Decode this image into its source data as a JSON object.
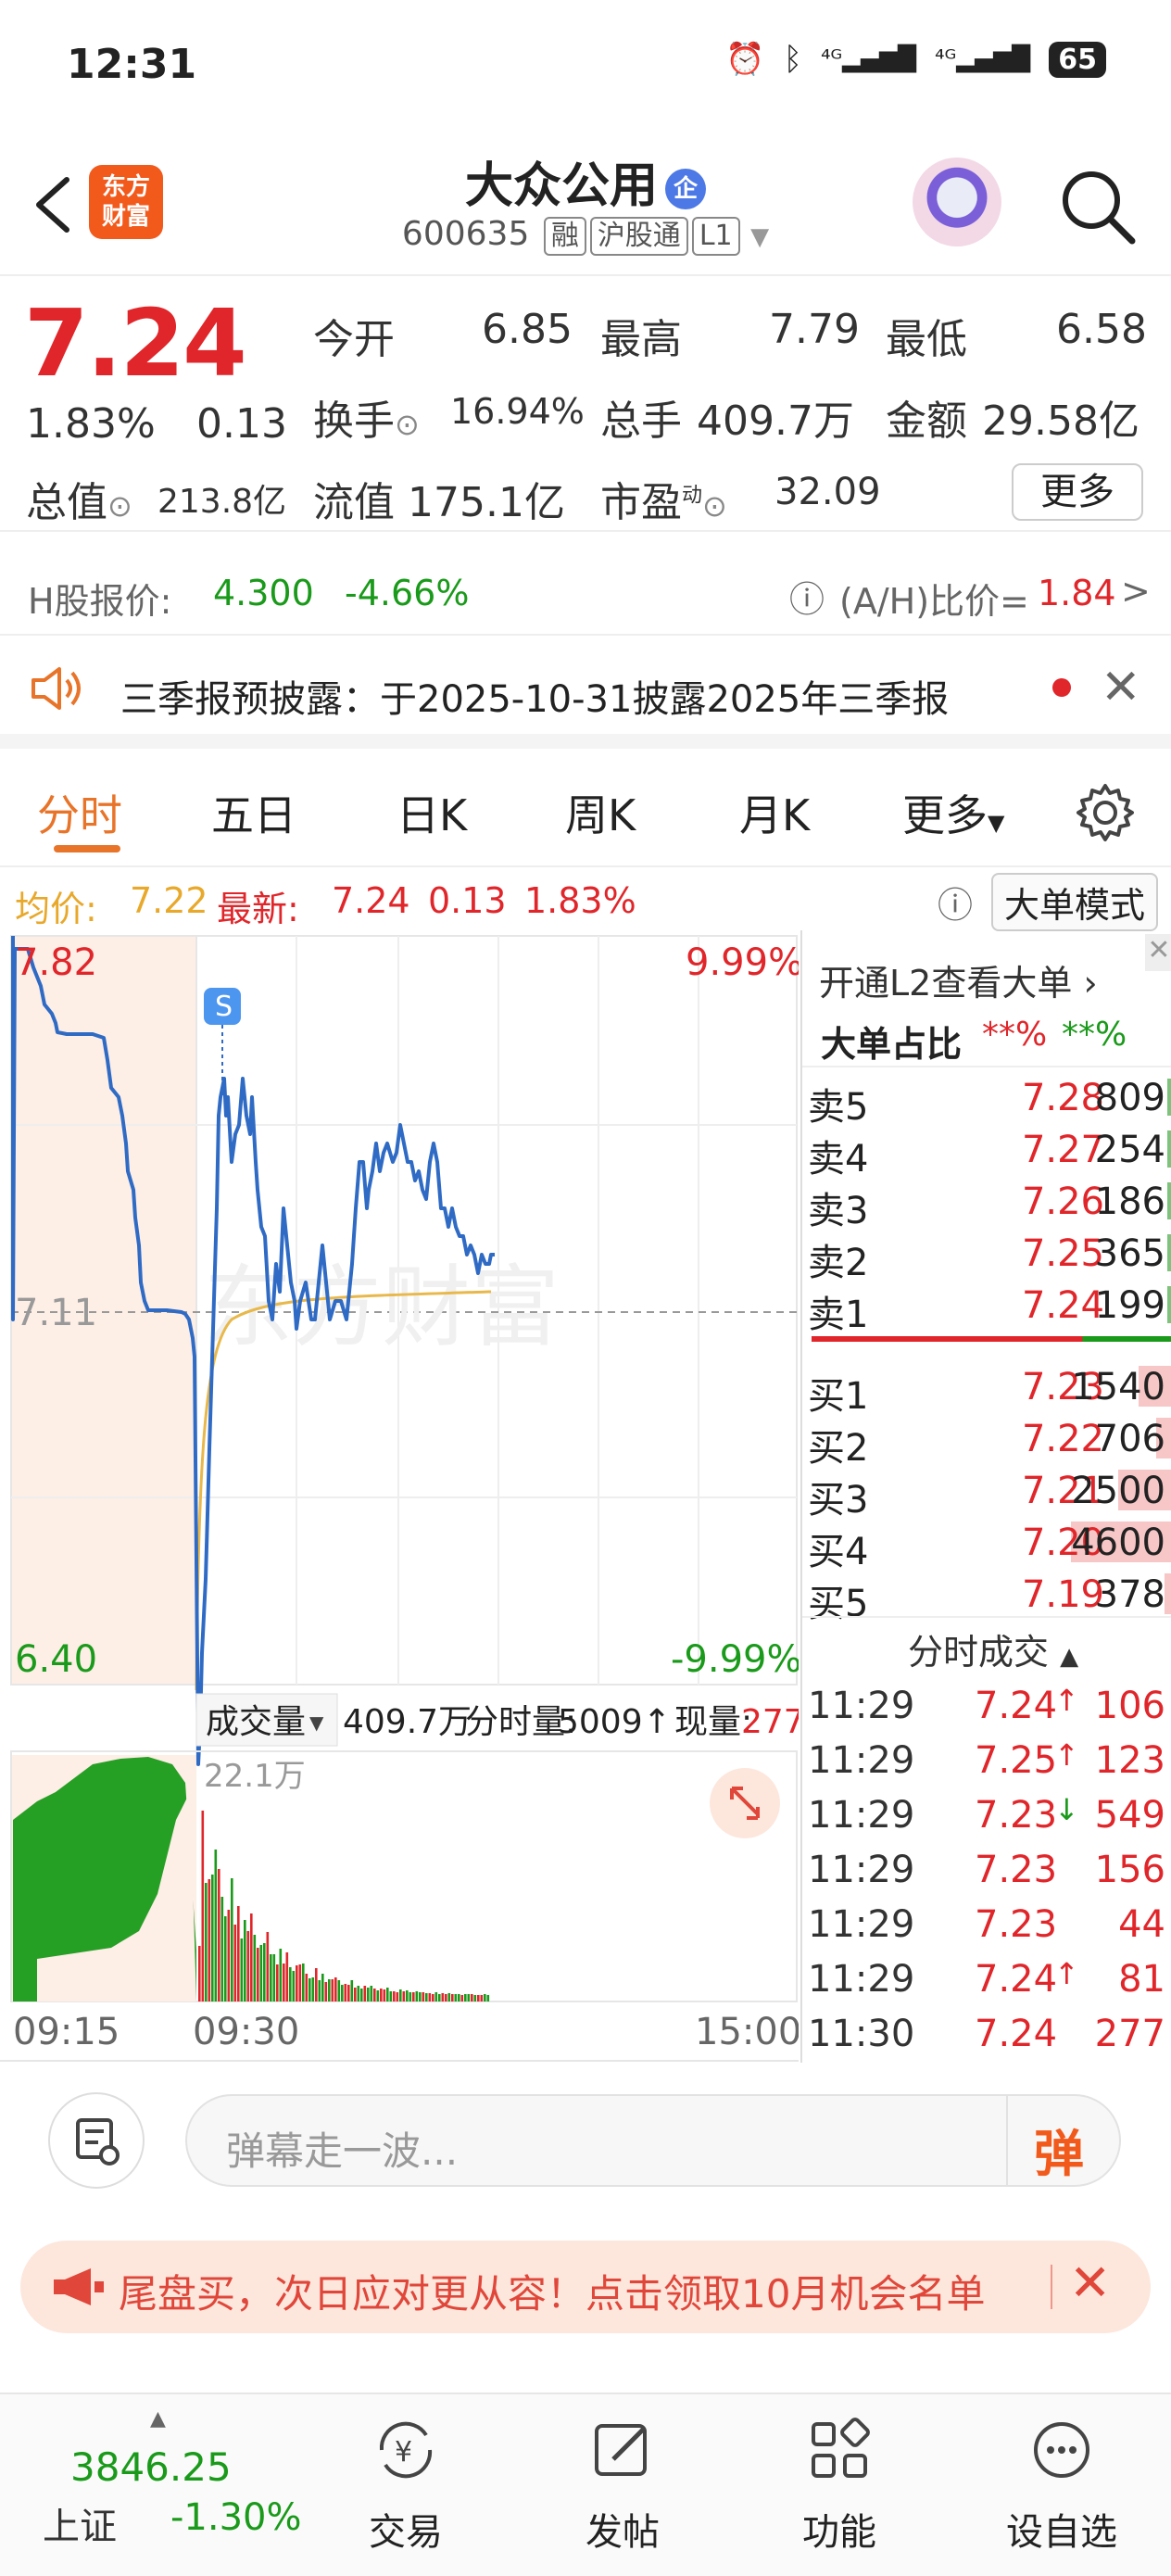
{
  "status_bar": {
    "time": "12:31",
    "battery": "65"
  },
  "header": {
    "title": "大众公用",
    "badge": "企",
    "code": "600635",
    "tags": [
      "融",
      "沪股通",
      "L1"
    ],
    "logo_text": "东方财富"
  },
  "quote": {
    "price": "7.24",
    "change_pct": "1.83%",
    "change": "0.13",
    "open_label": "今开",
    "open": "6.85",
    "high_label": "最高",
    "high": "7.79",
    "low_label": "最低",
    "low": "6.58",
    "turnover_label": "换手",
    "turnover": "16.94%",
    "volume_label": "总手",
    "volume": "409.7万",
    "amount_label": "金额",
    "amount": "29.58亿",
    "mktcap_label": "总值",
    "mktcap": "213.8亿",
    "float_label": "流值",
    "float": "175.1亿",
    "pe_label": "市盈",
    "pe_sup": "动",
    "pe": "32.09",
    "more": "更多"
  },
  "hshare": {
    "label": "H股报价:",
    "price": "4.300",
    "pct": "-4.66%",
    "ratio_label": "(A/H)比价=",
    "ratio": "1.84"
  },
  "notice": {
    "text": "三季报预披露：于2025-10-31披露2025年三季报"
  },
  "tabs": [
    "分时",
    "五日",
    "日K",
    "周K",
    "月K",
    "更多"
  ],
  "avg_line": {
    "avg_label": "均价:",
    "avg": "7.22",
    "last_label": "最新:",
    "last": "7.24",
    "chg": "0.13",
    "pct": "1.83%",
    "mode": "大单模式"
  },
  "chart": {
    "y_top": "7.82",
    "y_mid": "7.11",
    "y_bottom": "6.40",
    "pct_top": "9.99%",
    "pct_bottom": "-9.99%",
    "vol_label": "成交量",
    "vol_total": "409.7万",
    "per_min_label": "分时量:",
    "per_min": "5009",
    "now_label": "现量:",
    "now": "277",
    "vol_max": "22.1万",
    "times": [
      "09:15",
      "09:30",
      "15:00"
    ],
    "s_marker": "S",
    "watermark": "东方财富"
  },
  "depth": {
    "l2_text": "开通L2查看大单",
    "ratio_label": "大单占比",
    "ratio_a": "**%",
    "ratio_b": "**%",
    "sells": [
      {
        "label": "卖5",
        "price": "7.28",
        "vol": "809"
      },
      {
        "label": "卖4",
        "price": "7.27",
        "vol": "254"
      },
      {
        "label": "卖3",
        "price": "7.26",
        "vol": "186"
      },
      {
        "label": "卖2",
        "price": "7.25",
        "vol": "365"
      },
      {
        "label": "卖1",
        "price": "7.24",
        "vol": "199"
      }
    ],
    "buys": [
      {
        "label": "买1",
        "price": "7.23",
        "vol": "1540",
        "frac": 0.34
      },
      {
        "label": "买2",
        "price": "7.22",
        "vol": "706",
        "frac": 0.16
      },
      {
        "label": "买3",
        "price": "7.21",
        "vol": "2500",
        "frac": 0.54
      },
      {
        "label": "买4",
        "price": "7.20",
        "vol": "4600",
        "frac": 1.0
      },
      {
        "label": "买5",
        "price": "7.19",
        "vol": "378",
        "frac": 0.08
      }
    ],
    "ticks_title": "分时成交",
    "ticks": [
      {
        "time": "11:29",
        "price": "7.24",
        "dir": "↑",
        "vol": "106"
      },
      {
        "time": "11:29",
        "price": "7.25",
        "dir": "↑",
        "vol": "123"
      },
      {
        "time": "11:29",
        "price": "7.23",
        "dir": "↓",
        "vol": "549"
      },
      {
        "time": "11:29",
        "price": "7.23",
        "dir": "",
        "vol": "156"
      },
      {
        "time": "11:29",
        "price": "7.23",
        "dir": "",
        "vol": "44"
      },
      {
        "time": "11:29",
        "price": "7.24",
        "dir": "↑",
        "vol": "81"
      },
      {
        "time": "11:30",
        "price": "7.24",
        "dir": "",
        "vol": "277"
      }
    ]
  },
  "comment": {
    "placeholder": "弹幕走一波...",
    "danmu": "弹"
  },
  "banner": {
    "text": "尾盘买，次日应对更从容！点击领取10月机会名单"
  },
  "tabbar": {
    "index_value": "3846.25",
    "index_name": "上证",
    "index_pct": "-1.30%",
    "items": [
      "交易",
      "发帖",
      "功能",
      "设自选"
    ]
  }
}
